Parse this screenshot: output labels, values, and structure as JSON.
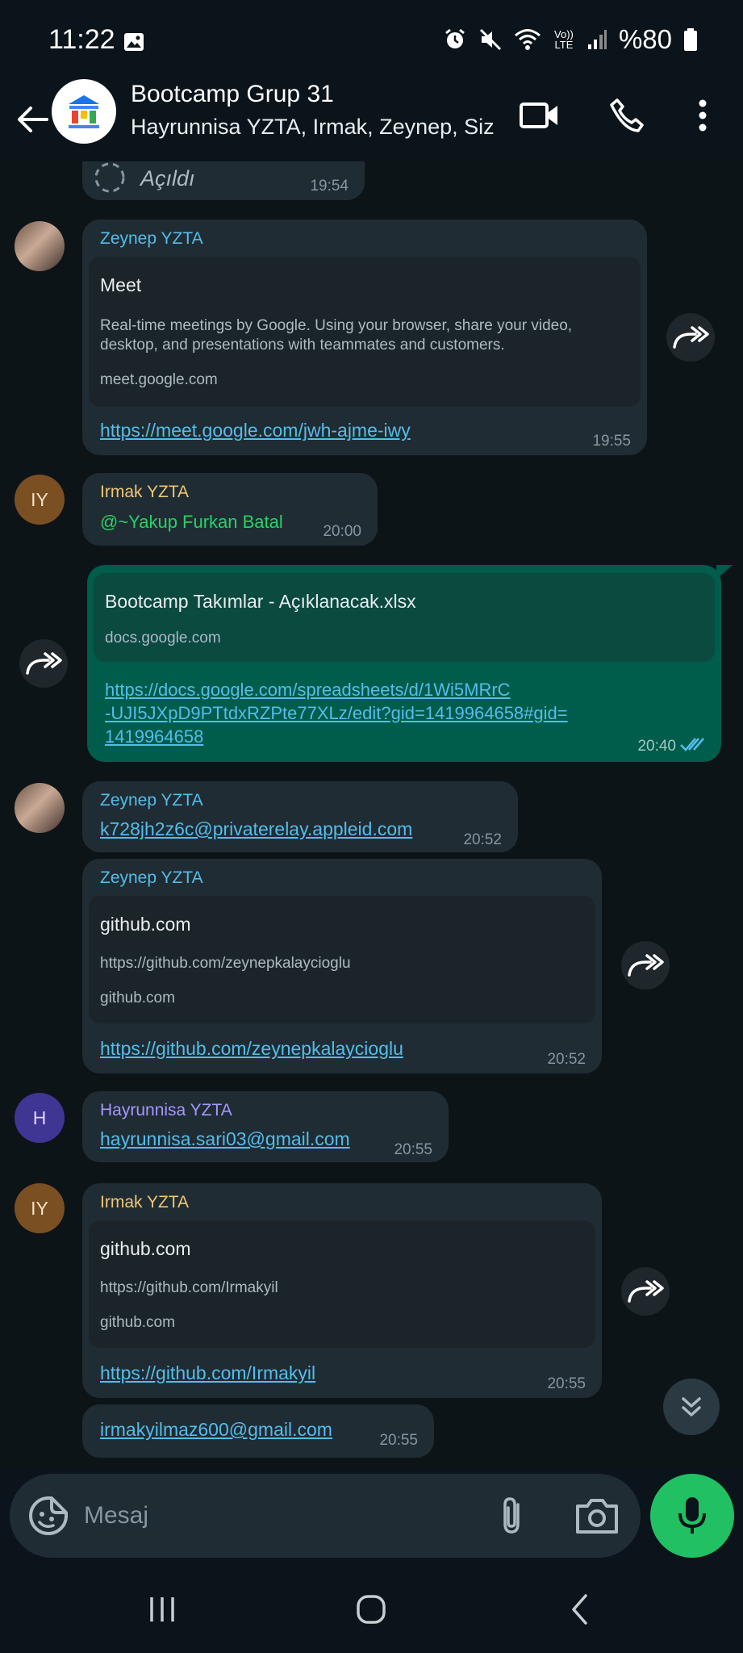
{
  "status_bar": {
    "time": "11:22",
    "battery": "%80",
    "volte_label": "Vo)) LTE"
  },
  "header": {
    "title": "Bootcamp Grup 31",
    "subtitle": "Hayrunnisa YZTA, Irmak, Zeynep, Siz"
  },
  "messages": {
    "m0": {
      "text": "Açıldı",
      "time": "19:54"
    },
    "m1": {
      "sender": "Zeynep YZTA",
      "preview_title": "Meet",
      "preview_desc": "Real-time meetings by Google. Using your browser, share your video, desktop, and presentations with teammates and customers.",
      "preview_domain": "meet.google.com",
      "link": "https://meet.google.com/jwh-ajme-iwy",
      "time": "19:55"
    },
    "m2": {
      "sender": "Irmak YZTA",
      "avatar": "IY",
      "mention": "@~Yakup Furkan Batal",
      "time": "20:00"
    },
    "m3": {
      "preview_title": "Bootcamp Takımlar - Açıklanacak.xlsx",
      "preview_domain": "docs.google.com",
      "link_line1": "https://docs.google.com/spreadsheets/d/1Wi5MRrC",
      "link_line2": "-UJI5JXpD9PTtdxRZPte77XLz/edit?gid=1419964658#gid=",
      "link_line3": "1419964658",
      "time": "20:40"
    },
    "m4": {
      "sender": "Zeynep YZTA",
      "link": "k728jh2z6c@privaterelay.appleid.com",
      "time": "20:52"
    },
    "m5": {
      "sender": "Zeynep YZTA",
      "preview_title": "github.com",
      "preview_desc": "https://github.com/zeynepkalaycioglu",
      "preview_domain": "github.com",
      "link": "https://github.com/zeynepkalaycioglu",
      "time": "20:52"
    },
    "m6": {
      "sender": "Hayrunnisa YZTA",
      "avatar": "H",
      "link": "hayrunnisa.sari03@gmail.com",
      "time": "20:55"
    },
    "m7": {
      "sender": "Irmak YZTA",
      "avatar": "IY",
      "preview_title": "github.com",
      "preview_desc": "https://github.com/Irmakyil",
      "preview_domain": "github.com",
      "link": "https://github.com/Irmakyil",
      "time": "20:55"
    },
    "m8": {
      "link": "irmakyilmaz600@gmail.com",
      "time": "20:55"
    }
  },
  "composer": {
    "placeholder": "Mesaj"
  },
  "colors": {
    "zeynep": "#53bdeb",
    "irmak": "#f0c674",
    "hayrunnisa": "#a597ff",
    "mention": "#25d366",
    "outgoing_bubble": "#005c4b",
    "incoming_bubble": "#202c33",
    "mic": "#21c063"
  }
}
